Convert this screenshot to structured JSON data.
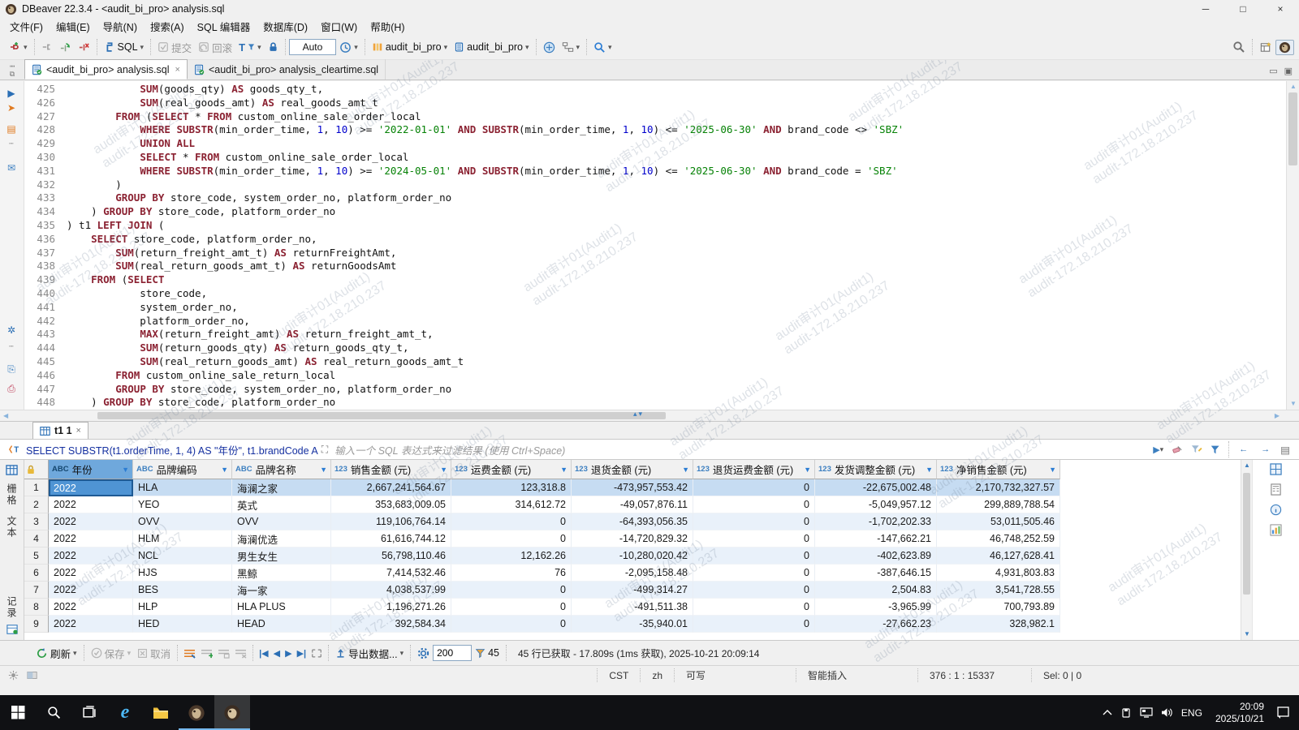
{
  "icons": {
    "chevron_down": "▾",
    "filter_arrow": "▼",
    "close": "×",
    "minimize": "─",
    "maximize": "□",
    "up": "▲",
    "down": "▼",
    "left": "◀",
    "right": "▶",
    "nav_first": "|◀",
    "nav_prev": "◀",
    "nav_next": "▶",
    "nav_last": "▶|",
    "sash": "▴▾",
    "dots": "┉",
    "expand": "⛶"
  },
  "window": {
    "title": "DBeaver 22.3.4 - <audit_bi_pro> analysis.sql"
  },
  "menu": {
    "items": [
      "文件(F)",
      "编辑(E)",
      "导航(N)",
      "搜索(A)",
      "SQL 编辑器",
      "数据库(D)",
      "窗口(W)",
      "帮助(H)"
    ]
  },
  "toolbar": {
    "sql": "SQL",
    "commit": "提交",
    "rollback": "回滚",
    "auto": "Auto",
    "database": "audit_bi_pro",
    "schema": "audit_bi_pro"
  },
  "editor": {
    "tabs": [
      {
        "label": "<audit_bi_pro> analysis.sql",
        "active": true
      },
      {
        "label": "<audit_bi_pro> analysis_cleartime.sql",
        "active": false
      }
    ],
    "watermark": {
      "line1": "audit审计01(Audit1)",
      "line2": "audit-172.18.210.237"
    },
    "code_lines": [
      {
        "no": "425",
        "segs": [
          [
            "            ",
            "d"
          ],
          [
            "SUM",
            "k"
          ],
          [
            "(goods_qty) ",
            "d"
          ],
          [
            "AS",
            "k"
          ],
          [
            " goods_qty_t,",
            "d"
          ]
        ]
      },
      {
        "no": "426",
        "segs": [
          [
            "            ",
            "d"
          ],
          [
            "SUM",
            "k"
          ],
          [
            "(real_goods_amt) ",
            "d"
          ],
          [
            "AS",
            "k"
          ],
          [
            " real_goods_amt_t",
            "d"
          ]
        ]
      },
      {
        "no": "427",
        "segs": [
          [
            "        ",
            "d"
          ],
          [
            "FROM",
            "k"
          ],
          [
            " (",
            "d"
          ],
          [
            "SELECT",
            "k"
          ],
          [
            " * ",
            "d"
          ],
          [
            "FROM",
            "k"
          ],
          [
            " custom_online_sale_order_local",
            "d"
          ]
        ]
      },
      {
        "no": "428",
        "segs": [
          [
            "            ",
            "d"
          ],
          [
            "WHERE",
            "k"
          ],
          [
            " ",
            "d"
          ],
          [
            "SUBSTR",
            "k"
          ],
          [
            "(min_order_time, ",
            "d"
          ],
          [
            "1",
            "n"
          ],
          [
            ", ",
            "d"
          ],
          [
            "10",
            "n"
          ],
          [
            ") >= ",
            "d"
          ],
          [
            "'2022-01-01'",
            "s"
          ],
          [
            " ",
            "d"
          ],
          [
            "AND",
            "k"
          ],
          [
            " ",
            "d"
          ],
          [
            "SUBSTR",
            "k"
          ],
          [
            "(min_order_time, ",
            "d"
          ],
          [
            "1",
            "n"
          ],
          [
            ", ",
            "d"
          ],
          [
            "10",
            "n"
          ],
          [
            ") <= ",
            "d"
          ],
          [
            "'2025-06-30'",
            "s"
          ],
          [
            " ",
            "d"
          ],
          [
            "AND",
            "k"
          ],
          [
            " brand_code <> ",
            "d"
          ],
          [
            "'SBZ'",
            "s"
          ]
        ]
      },
      {
        "no": "429",
        "segs": [
          [
            "            ",
            "d"
          ],
          [
            "UNION ALL",
            "k"
          ]
        ]
      },
      {
        "no": "430",
        "segs": [
          [
            "            ",
            "d"
          ],
          [
            "SELECT",
            "k"
          ],
          [
            " * ",
            "d"
          ],
          [
            "FROM",
            "k"
          ],
          [
            " custom_online_sale_order_local",
            "d"
          ]
        ]
      },
      {
        "no": "431",
        "segs": [
          [
            "            ",
            "d"
          ],
          [
            "WHERE",
            "k"
          ],
          [
            " ",
            "d"
          ],
          [
            "SUBSTR",
            "k"
          ],
          [
            "(min_order_time, ",
            "d"
          ],
          [
            "1",
            "n"
          ],
          [
            ", ",
            "d"
          ],
          [
            "10",
            "n"
          ],
          [
            ") >= ",
            "d"
          ],
          [
            "'2024-05-01'",
            "s"
          ],
          [
            " ",
            "d"
          ],
          [
            "AND",
            "k"
          ],
          [
            " ",
            "d"
          ],
          [
            "SUBSTR",
            "k"
          ],
          [
            "(min_order_time, ",
            "d"
          ],
          [
            "1",
            "n"
          ],
          [
            ", ",
            "d"
          ],
          [
            "10",
            "n"
          ],
          [
            ") <= ",
            "d"
          ],
          [
            "'2025-06-30'",
            "s"
          ],
          [
            " ",
            "d"
          ],
          [
            "AND",
            "k"
          ],
          [
            " brand_code = ",
            "d"
          ],
          [
            "'SBZ'",
            "s"
          ]
        ]
      },
      {
        "no": "432",
        "segs": [
          [
            "        )",
            "d"
          ]
        ]
      },
      {
        "no": "433",
        "segs": [
          [
            "        ",
            "d"
          ],
          [
            "GROUP BY",
            "k"
          ],
          [
            " store_code, system_order_no, platform_order_no",
            "d"
          ]
        ]
      },
      {
        "no": "434",
        "segs": [
          [
            "    ) ",
            "d"
          ],
          [
            "GROUP BY",
            "k"
          ],
          [
            " store_code, platform_order_no",
            "d"
          ]
        ]
      },
      {
        "no": "435",
        "segs": [
          [
            ") t1 ",
            "d"
          ],
          [
            "LEFT JOIN",
            "k"
          ],
          [
            " (",
            "d"
          ]
        ]
      },
      {
        "no": "436",
        "segs": [
          [
            "    ",
            "d"
          ],
          [
            "SELECT",
            "k"
          ],
          [
            " store_code, platform_order_no,",
            "d"
          ]
        ]
      },
      {
        "no": "437",
        "segs": [
          [
            "        ",
            "d"
          ],
          [
            "SUM",
            "k"
          ],
          [
            "(return_freight_amt_t) ",
            "d"
          ],
          [
            "AS",
            "k"
          ],
          [
            " returnFreightAmt,",
            "d"
          ]
        ]
      },
      {
        "no": "438",
        "segs": [
          [
            "        ",
            "d"
          ],
          [
            "SUM",
            "k"
          ],
          [
            "(real_return_goods_amt_t) ",
            "d"
          ],
          [
            "AS",
            "k"
          ],
          [
            " returnGoodsAmt",
            "d"
          ]
        ]
      },
      {
        "no": "439",
        "segs": [
          [
            "    ",
            "d"
          ],
          [
            "FROM",
            "k"
          ],
          [
            " (",
            "d"
          ],
          [
            "SELECT",
            "k"
          ]
        ]
      },
      {
        "no": "440",
        "segs": [
          [
            "            store_code,",
            "d"
          ]
        ]
      },
      {
        "no": "441",
        "segs": [
          [
            "            system_order_no,",
            "d"
          ]
        ]
      },
      {
        "no": "442",
        "segs": [
          [
            "            platform_order_no,",
            "d"
          ]
        ]
      },
      {
        "no": "443",
        "segs": [
          [
            "            ",
            "d"
          ],
          [
            "MAX",
            "k"
          ],
          [
            "(return_freight_amt) ",
            "d"
          ],
          [
            "AS",
            "k"
          ],
          [
            " return_freight_amt_t,",
            "d"
          ]
        ]
      },
      {
        "no": "444",
        "segs": [
          [
            "            ",
            "d"
          ],
          [
            "SUM",
            "k"
          ],
          [
            "(return_goods_qty) ",
            "d"
          ],
          [
            "AS",
            "k"
          ],
          [
            " return_goods_qty_t,",
            "d"
          ]
        ]
      },
      {
        "no": "445",
        "segs": [
          [
            "            ",
            "d"
          ],
          [
            "SUM",
            "k"
          ],
          [
            "(real_return_goods_amt) ",
            "d"
          ],
          [
            "AS",
            "k"
          ],
          [
            " real_return_goods_amt_t",
            "d"
          ]
        ]
      },
      {
        "no": "446",
        "segs": [
          [
            "        ",
            "d"
          ],
          [
            "FROM",
            "k"
          ],
          [
            " custom_online_sale_return_local",
            "d"
          ]
        ]
      },
      {
        "no": "447",
        "segs": [
          [
            "        ",
            "d"
          ],
          [
            "GROUP BY",
            "k"
          ],
          [
            " store_code, system_order_no, platform_order_no",
            "d"
          ]
        ]
      },
      {
        "no": "448",
        "segs": [
          [
            "    ) ",
            "d"
          ],
          [
            "GROUP BY",
            "k"
          ],
          [
            " store_code, platform_order_no",
            "d"
          ]
        ]
      }
    ]
  },
  "results": {
    "tab_label": "t1 1",
    "filter": {
      "expression": "SELECT SUBSTR(t1.orderTime, 1, 4) AS \"年份\", t1.brandCode A",
      "placeholder": "输入一个 SQL 表达式来过滤结果 (使用 Ctrl+Space)"
    },
    "side_tabs": {
      "grid": "栅格",
      "text": "文本",
      "record": "记录"
    },
    "grid": {
      "columns": [
        {
          "type": "ABC",
          "label": "年份"
        },
        {
          "type": "ABC",
          "label": "品牌编码"
        },
        {
          "type": "ABC",
          "label": "品牌名称"
        },
        {
          "type": "123",
          "label": "销售金额 (元)"
        },
        {
          "type": "123",
          "label": "运费金额 (元)"
        },
        {
          "type": "123",
          "label": "退货金额 (元)"
        },
        {
          "type": "123",
          "label": "退货运费金额 (元)"
        },
        {
          "type": "123",
          "label": "发货调整金额 (元)"
        },
        {
          "type": "123",
          "label": "净销售金额 (元)"
        }
      ],
      "rows": [
        [
          "2022",
          "HLA",
          "海澜之家",
          "2,667,241,564.67",
          "123,318.8",
          "-473,957,553.42",
          "0",
          "-22,675,002.48",
          "2,170,732,327.57"
        ],
        [
          "2022",
          "YEO",
          "英式",
          "353,683,009.05",
          "314,612.72",
          "-49,057,876.11",
          "0",
          "-5,049,957.12",
          "299,889,788.54"
        ],
        [
          "2022",
          "OVV",
          "OVV",
          "119,106,764.14",
          "0",
          "-64,393,056.35",
          "0",
          "-1,702,202.33",
          "53,011,505.46"
        ],
        [
          "2022",
          "HLM",
          "海澜优选",
          "61,616,744.12",
          "0",
          "-14,720,829.32",
          "0",
          "-147,662.21",
          "46,748,252.59"
        ],
        [
          "2022",
          "NCL",
          "男生女生",
          "56,798,110.46",
          "12,162.26",
          "-10,280,020.42",
          "0",
          "-402,623.89",
          "46,127,628.41"
        ],
        [
          "2022",
          "HJS",
          "黑鲸",
          "7,414,532.46",
          "76",
          "-2,095,158.48",
          "0",
          "-387,646.15",
          "4,931,803.83"
        ],
        [
          "2022",
          "BES",
          "海一家",
          "4,038,537.99",
          "0",
          "-499,314.27",
          "0",
          "2,504.83",
          "3,541,728.55"
        ],
        [
          "2022",
          "HLP",
          "HLA PLUS",
          "1,196,271.26",
          "0",
          "-491,511.38",
          "0",
          "-3,965.99",
          "700,793.89"
        ],
        [
          "2022",
          "HED",
          "HEAD",
          "392,584.34",
          "0",
          "-35,940.01",
          "0",
          "-27,662.23",
          "328,982.1"
        ]
      ]
    },
    "toolbar": {
      "refresh": "刷新",
      "save": "保存",
      "cancel": "取消",
      "export": "导出数据...",
      "fetch_size": "200",
      "row_count": "45",
      "status": "45 行已获取 - 17.809s (1ms 获取), 2025-10-21 20:09:14"
    }
  },
  "statusbar": {
    "timezone": "CST",
    "language": "zh",
    "writable": "可写",
    "insert_mode": "智能插入",
    "caret_position": "376 : 1 : 15337",
    "selection": "Sel: 0 | 0"
  },
  "taskbar": {
    "input_lang": "ENG",
    "time": "20:09",
    "date": "2025/10/21"
  }
}
